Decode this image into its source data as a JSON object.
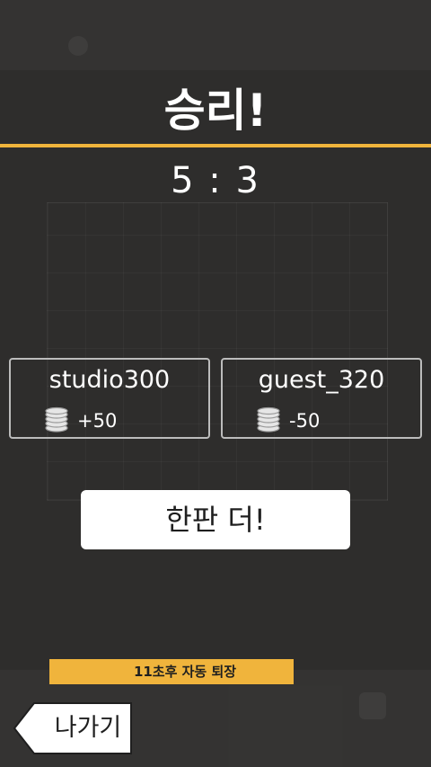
{
  "result": {
    "title": "승리!",
    "score": "5 : 3"
  },
  "players": [
    {
      "name": "studio300",
      "coin_delta": "+50",
      "icon": "coins-icon"
    },
    {
      "name": "guest_320",
      "coin_delta": "-50",
      "icon": "coins-icon"
    }
  ],
  "actions": {
    "play_again_label": "한판 더!",
    "auto_exit_notice": "11초후 자동 퇴장",
    "exit_label": "나가기"
  },
  "colors": {
    "background": "#2e2d2c",
    "accent": "#f0b43c",
    "button": "#ffffff",
    "card_border": "#bcbcbc"
  }
}
